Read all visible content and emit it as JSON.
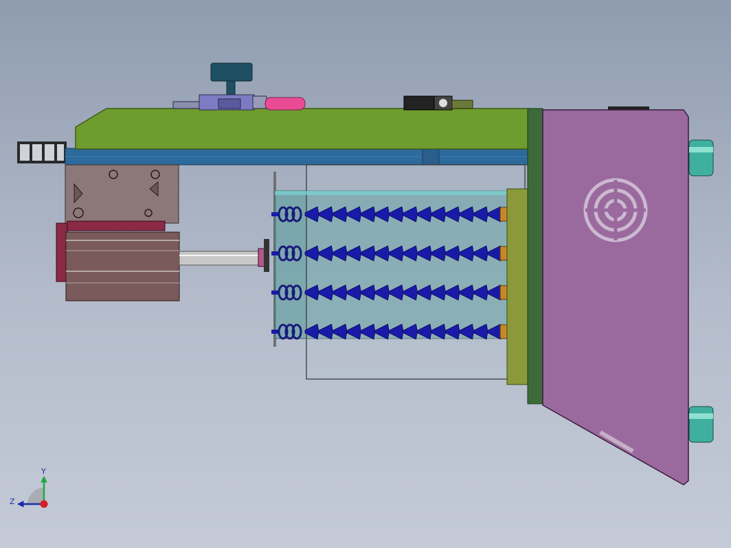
{
  "viewport": {
    "background_top": "#8f9cb0",
    "background_bottom": "#c4cad7"
  },
  "colors": {
    "top_plate": "#6e9c2e",
    "rail": "#2c6a9c",
    "door": "#9a6a9e",
    "hose": "#1a1aa8",
    "enclosure": "#5f9ea0",
    "cylinder": "#7a5a5a",
    "knob": "#1f4f63",
    "mount_plate": "#3e6a3a",
    "standoff": "#3fb0a0"
  },
  "nozzle_rows": 4,
  "nozzle_segments": 14,
  "triad": {
    "y_label": "Y",
    "z_label": "Z",
    "y_color": "#1fa83f",
    "z_color": "#1a2aa8",
    "x_color": "#d42020"
  }
}
